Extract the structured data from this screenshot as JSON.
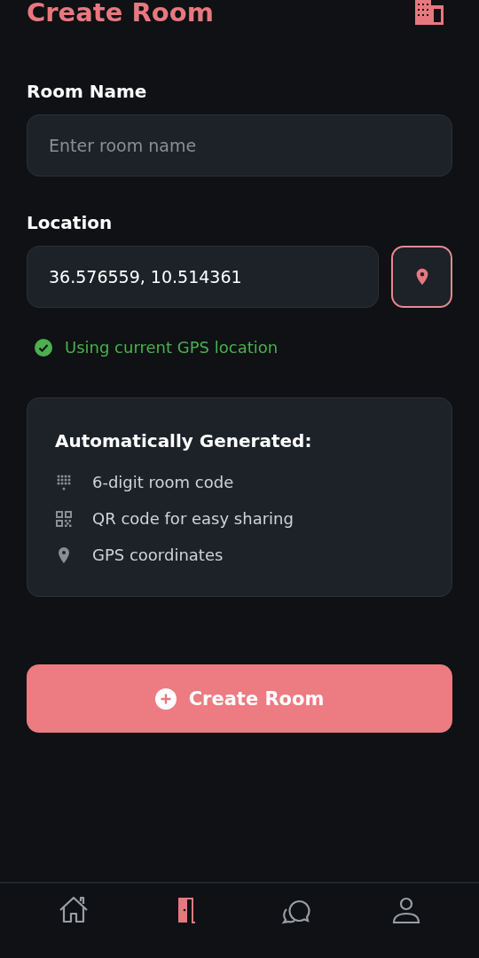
{
  "header": {
    "title": "Create Room"
  },
  "room_name": {
    "label": "Room Name",
    "placeholder": "Enter room name"
  },
  "location": {
    "label": "Location",
    "value": "36.576559, 10.514361",
    "status": "Using current GPS location"
  },
  "info_card": {
    "title": "Automatically Generated:",
    "items": [
      {
        "kind": "keypad",
        "text": "6-digit room code"
      },
      {
        "kind": "qr",
        "text": "QR code for easy sharing"
      },
      {
        "kind": "pin",
        "text": "GPS coordinates"
      }
    ]
  },
  "submit": {
    "label": "Create Room"
  },
  "bottom_nav": [
    {
      "kind": "home",
      "selected": false
    },
    {
      "kind": "door",
      "selected": true
    },
    {
      "kind": "chat",
      "selected": false
    },
    {
      "kind": "person",
      "selected": false
    }
  ]
}
